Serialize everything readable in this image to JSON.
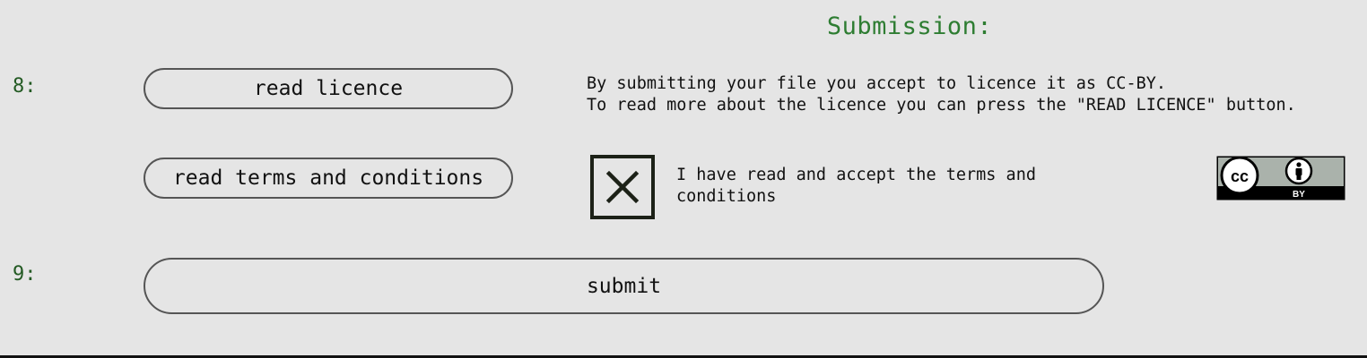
{
  "section": {
    "title": "Submission:"
  },
  "steps": [
    {
      "number": "8:"
    },
    {
      "number": "9:"
    }
  ],
  "buttons": {
    "read_licence": "read licence",
    "read_terms": "read terms and conditions",
    "submit": "submit"
  },
  "licence_notice": {
    "line1": "By submitting your file you accept to licence it as CC-BY.",
    "line2": "To read more about the licence you can press the \"READ LICENCE\" button."
  },
  "terms": {
    "checkbox_state": "checked",
    "label": "I have read and accept the terms and conditions"
  },
  "licence_badge": {
    "icon": "cc-by-icon",
    "symbol": "cc",
    "caption": "BY"
  },
  "colors": {
    "background": "#e5e5e5",
    "title_green": "#2e7d32",
    "step_green": "#235a23",
    "border": "#555555"
  }
}
